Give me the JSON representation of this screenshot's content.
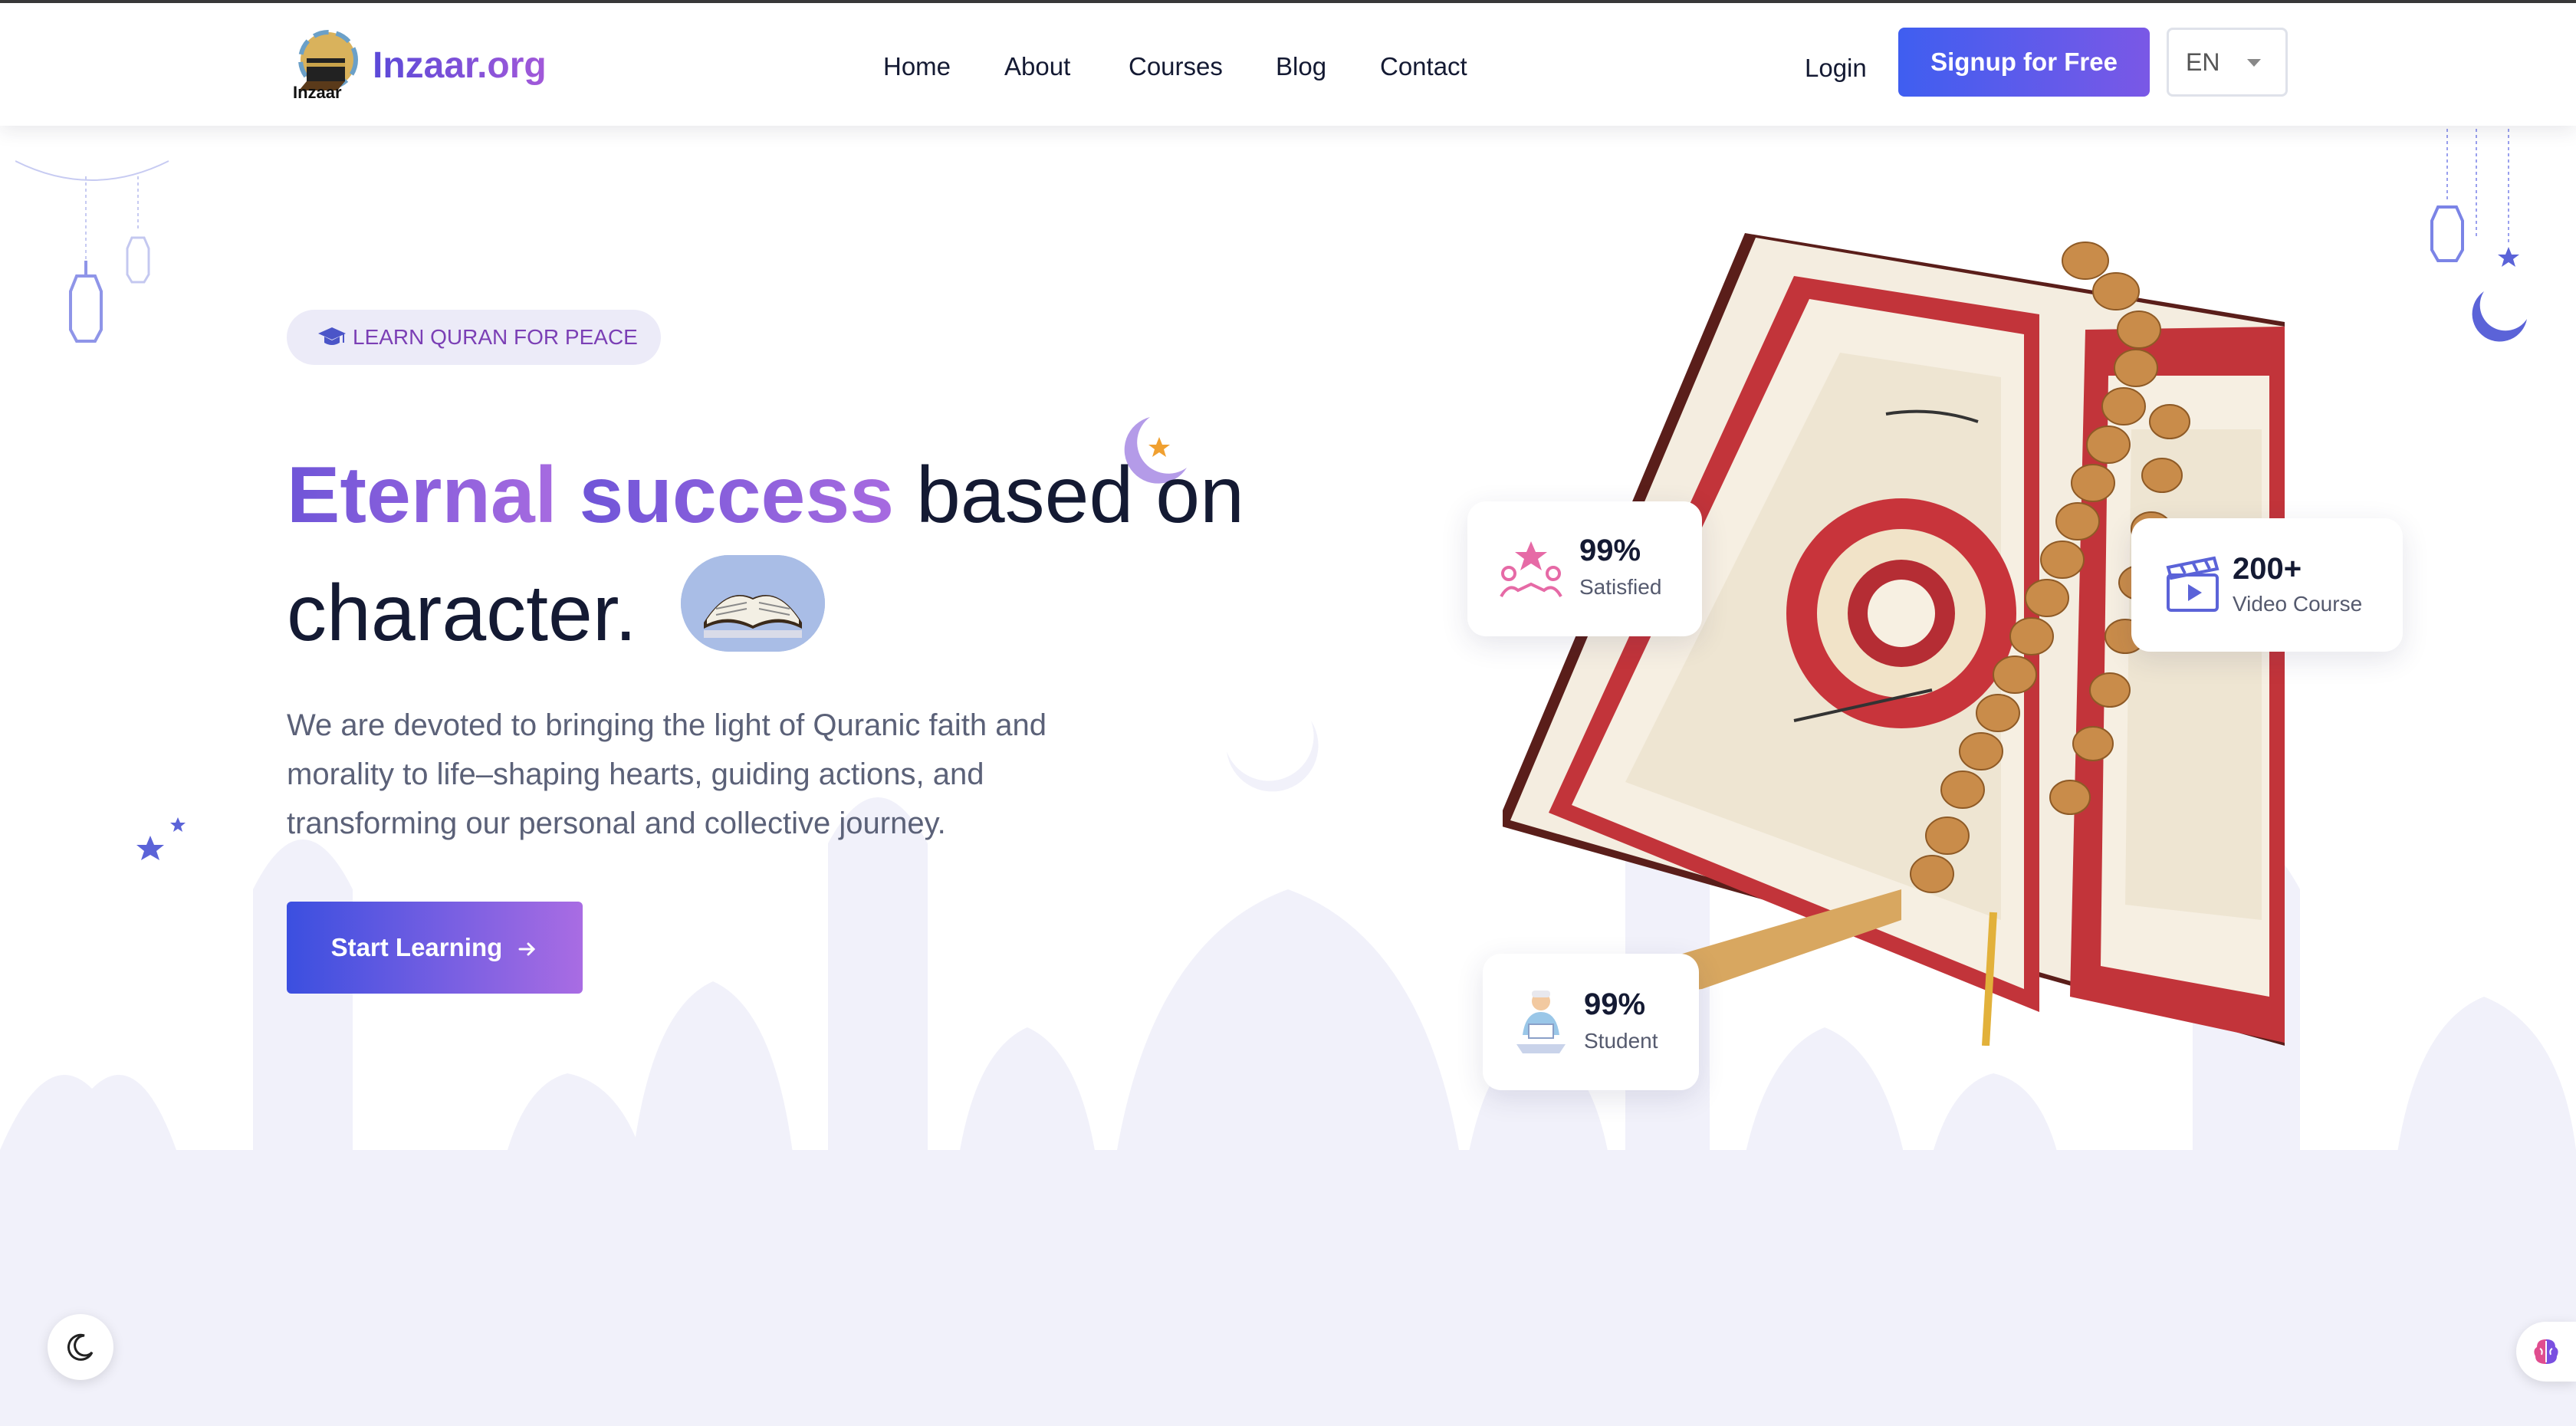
{
  "brand": {
    "name": "Inzaar.org",
    "logo_sub": "Inzaar"
  },
  "nav": {
    "home": "Home",
    "about": "About",
    "courses": "Courses",
    "blog": "Blog",
    "contact": "Contact"
  },
  "auth": {
    "login": "Login",
    "signup": "Signup for Free"
  },
  "language": {
    "selected": "EN"
  },
  "hero": {
    "badge": "LEARN QURAN FOR PEACE",
    "title_highlight_1": "Eternal",
    "title_highlight_2": "success",
    "title_rest": "based on",
    "title_line2": "character.",
    "description": "We are devoted to bringing the light of Quranic faith and morality to life–shaping hearts, guiding actions, and transforming our personal and collective journey.",
    "cta": "Start Learning"
  },
  "stats": {
    "satisfied": {
      "value": "99%",
      "label": "Satisfied"
    },
    "courses": {
      "value": "200+",
      "label": "Video Course"
    },
    "students": {
      "value": "99%",
      "label": "Student"
    }
  },
  "colors": {
    "primary": "#3f5ef0",
    "accent": "#a259d9",
    "text": "#141a33",
    "muted": "#5b6178",
    "badge_bg": "#ecebf8"
  },
  "icons": {
    "badge": "graduation-cap-icon",
    "cta": "arrow-right-icon",
    "satisfied": "people-star-icon",
    "courses": "clapperboard-icon",
    "students": "student-reading-icon",
    "theme": "moon-icon",
    "widget": "brain-icon"
  }
}
